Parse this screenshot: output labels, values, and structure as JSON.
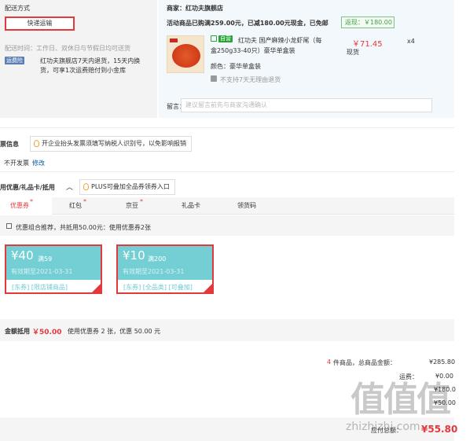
{
  "delivery": {
    "section_title": "配送方式",
    "method_button": "快递运输",
    "time_label": "配送时间：工作日、双休日与节假日均可送货",
    "service_icon": "运费险",
    "service_text_1": "红功夫旗舰店7天内退货，15天内换",
    "service_text_2": "货，可享1次运费赔付到小金库"
  },
  "shop": {
    "merchant": "商家：红功夫旗舰店",
    "promo": "活动商品已购满259.00元，已减180.00元现金，已免邮",
    "rebate": "返现：￥180.00",
    "product": {
      "badge": "自营",
      "name_line1": "红功夫 国产麻辣小龙虾尾（每",
      "name_line2": "盒250g33-40只）豪华单盒装",
      "color_label": "颜色：",
      "color_value": "豪华单盒装",
      "return_note": "不支持7天无理由退货",
      "price": "￥71.45",
      "qty": "x4",
      "stock": "现货"
    },
    "note_label": "留言：",
    "note_placeholder": "建议留言前先与商家沟通确认"
  },
  "invoice": {
    "title": "票信息",
    "tip": "开企业抬头发票须填写纳税人识别号，以免影响报销",
    "value": "不开发票",
    "edit": "修改"
  },
  "discount": {
    "title": "用优惠/礼品卡/抵用",
    "plus_tip": "PLUS可叠加全品券领券入口",
    "tabs": [
      "优惠券",
      "红包",
      "京豆",
      "礼品卡",
      "领货码"
    ],
    "combo_text": "优惠组合推荐，共抵用50.00元：使用优惠券2张",
    "coupons": [
      {
        "amount": "¥40",
        "condition": "满59",
        "expiry": "有效期至2021-03-31",
        "tags": "[东券]  [限店铺商品]"
      },
      {
        "amount": "¥10",
        "condition": "满200",
        "expiry": "有效期至2021-03-31",
        "tags": "[东券]  [全品类]  [可叠加]"
      }
    ],
    "total_label": "金额抵用",
    "total_value": "￥50.00",
    "total_note": "使用优惠券 2 张，优惠 50.00 元"
  },
  "summary": {
    "count_num": "4",
    "count_text": "件商品，总商品金额：",
    "goods_total": "¥285.80",
    "shipping_label": "运费：",
    "shipping_value": "¥0.00",
    "line3_value": "¥180.0",
    "line4_value": "¥50.00",
    "pay_label": "应付总额：",
    "pay_value": "¥55.80"
  },
  "watermark": {
    "chars": "值值值",
    "url": "zhizhizhi.com"
  },
  "colors": {
    "accent_red": "#e4393c",
    "coupon_cyan": "#74cfd5",
    "promo_green": "#3f9f4a"
  }
}
